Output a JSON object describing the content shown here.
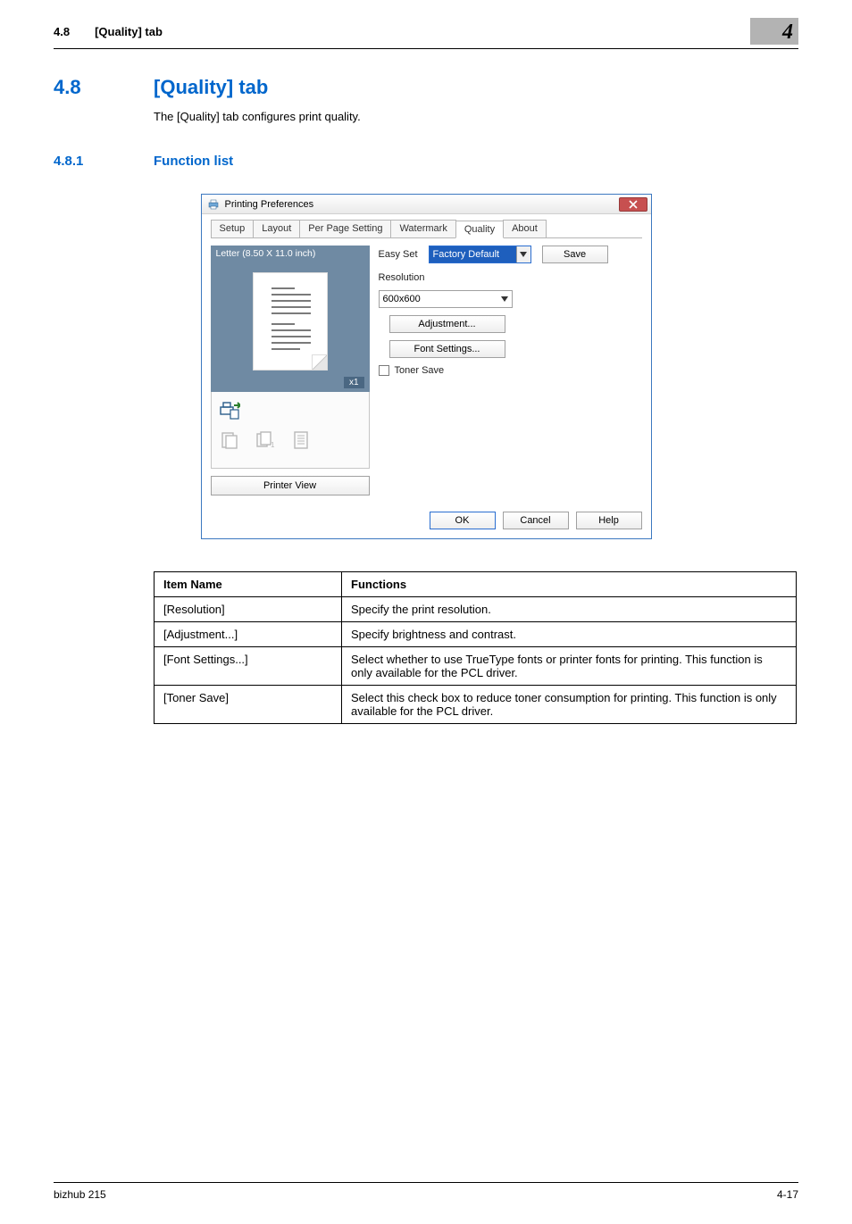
{
  "header": {
    "section_ref": "4.8",
    "section_ref_title": "[Quality] tab",
    "chapter": "4"
  },
  "section": {
    "number": "4.8",
    "title": "[Quality] tab",
    "description": "The [Quality] tab configures print quality."
  },
  "subsection": {
    "number": "4.8.1",
    "title": "Function list"
  },
  "dialog": {
    "title": "Printing Preferences",
    "tabs": [
      "Setup",
      "Layout",
      "Per Page Setting",
      "Watermark",
      "Quality",
      "About"
    ],
    "active_tab": "Quality",
    "preview": {
      "paper_label": "Letter (8.50 X 11.0 inch)",
      "copies_badge": "x1",
      "printer_view_button": "Printer View"
    },
    "easyset": {
      "label": "Easy Set",
      "value": "Factory Default",
      "save_button": "Save"
    },
    "resolution": {
      "label": "Resolution",
      "value": "600x600"
    },
    "adjustment_button": "Adjustment...",
    "font_settings_button": "Font Settings...",
    "toner_save": {
      "label": "Toner Save",
      "checked": false
    },
    "footer": {
      "ok": "OK",
      "cancel": "Cancel",
      "help": "Help"
    }
  },
  "table": {
    "head": {
      "col1": "Item Name",
      "col2": "Functions"
    },
    "rows": [
      {
        "name": "[Resolution]",
        "func": "Specify the print resolution."
      },
      {
        "name": "[Adjustment...]",
        "func": "Specify brightness and contrast."
      },
      {
        "name": "[Font Settings...]",
        "func": "Select whether to use TrueType fonts or printer fonts for printing. This function is only available for the PCL driver."
      },
      {
        "name": "[Toner Save]",
        "func": "Select this check box to reduce toner consumption for printing. This function is only available for the PCL driver."
      }
    ]
  },
  "footer": {
    "left": "bizhub 215",
    "right": "4-17"
  }
}
